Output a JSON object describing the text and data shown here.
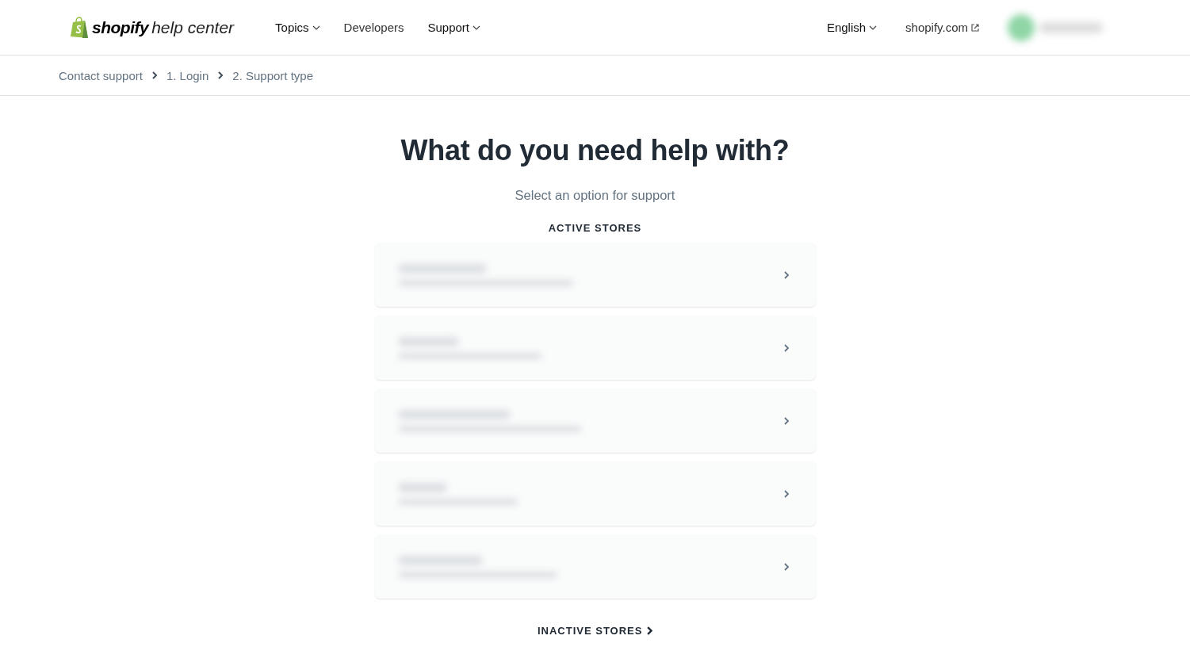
{
  "header": {
    "logo": {
      "brand": "shopify",
      "product": "help center"
    },
    "nav": [
      {
        "label": "Topics",
        "dropdown": true
      },
      {
        "label": "Developers",
        "dropdown": false
      },
      {
        "label": "Support",
        "dropdown": true
      }
    ],
    "language": {
      "label": "English",
      "dropdown": true
    },
    "site_link": {
      "label": "shopify.com",
      "external": true
    },
    "account": {
      "kind": "redacted"
    }
  },
  "breadcrumbs": [
    "Contact support",
    "1. Login",
    "2. Support type"
  ],
  "heading": "What do you need help with?",
  "subheading": "Select an option for support",
  "active_section": {
    "title": "ACTIVE STORES",
    "stores": [
      {
        "kind": "redacted"
      },
      {
        "kind": "redacted"
      },
      {
        "kind": "redacted"
      },
      {
        "kind": "redacted"
      },
      {
        "kind": "redacted"
      }
    ]
  },
  "inactive_link": {
    "label": "INACTIVE STORES"
  }
}
